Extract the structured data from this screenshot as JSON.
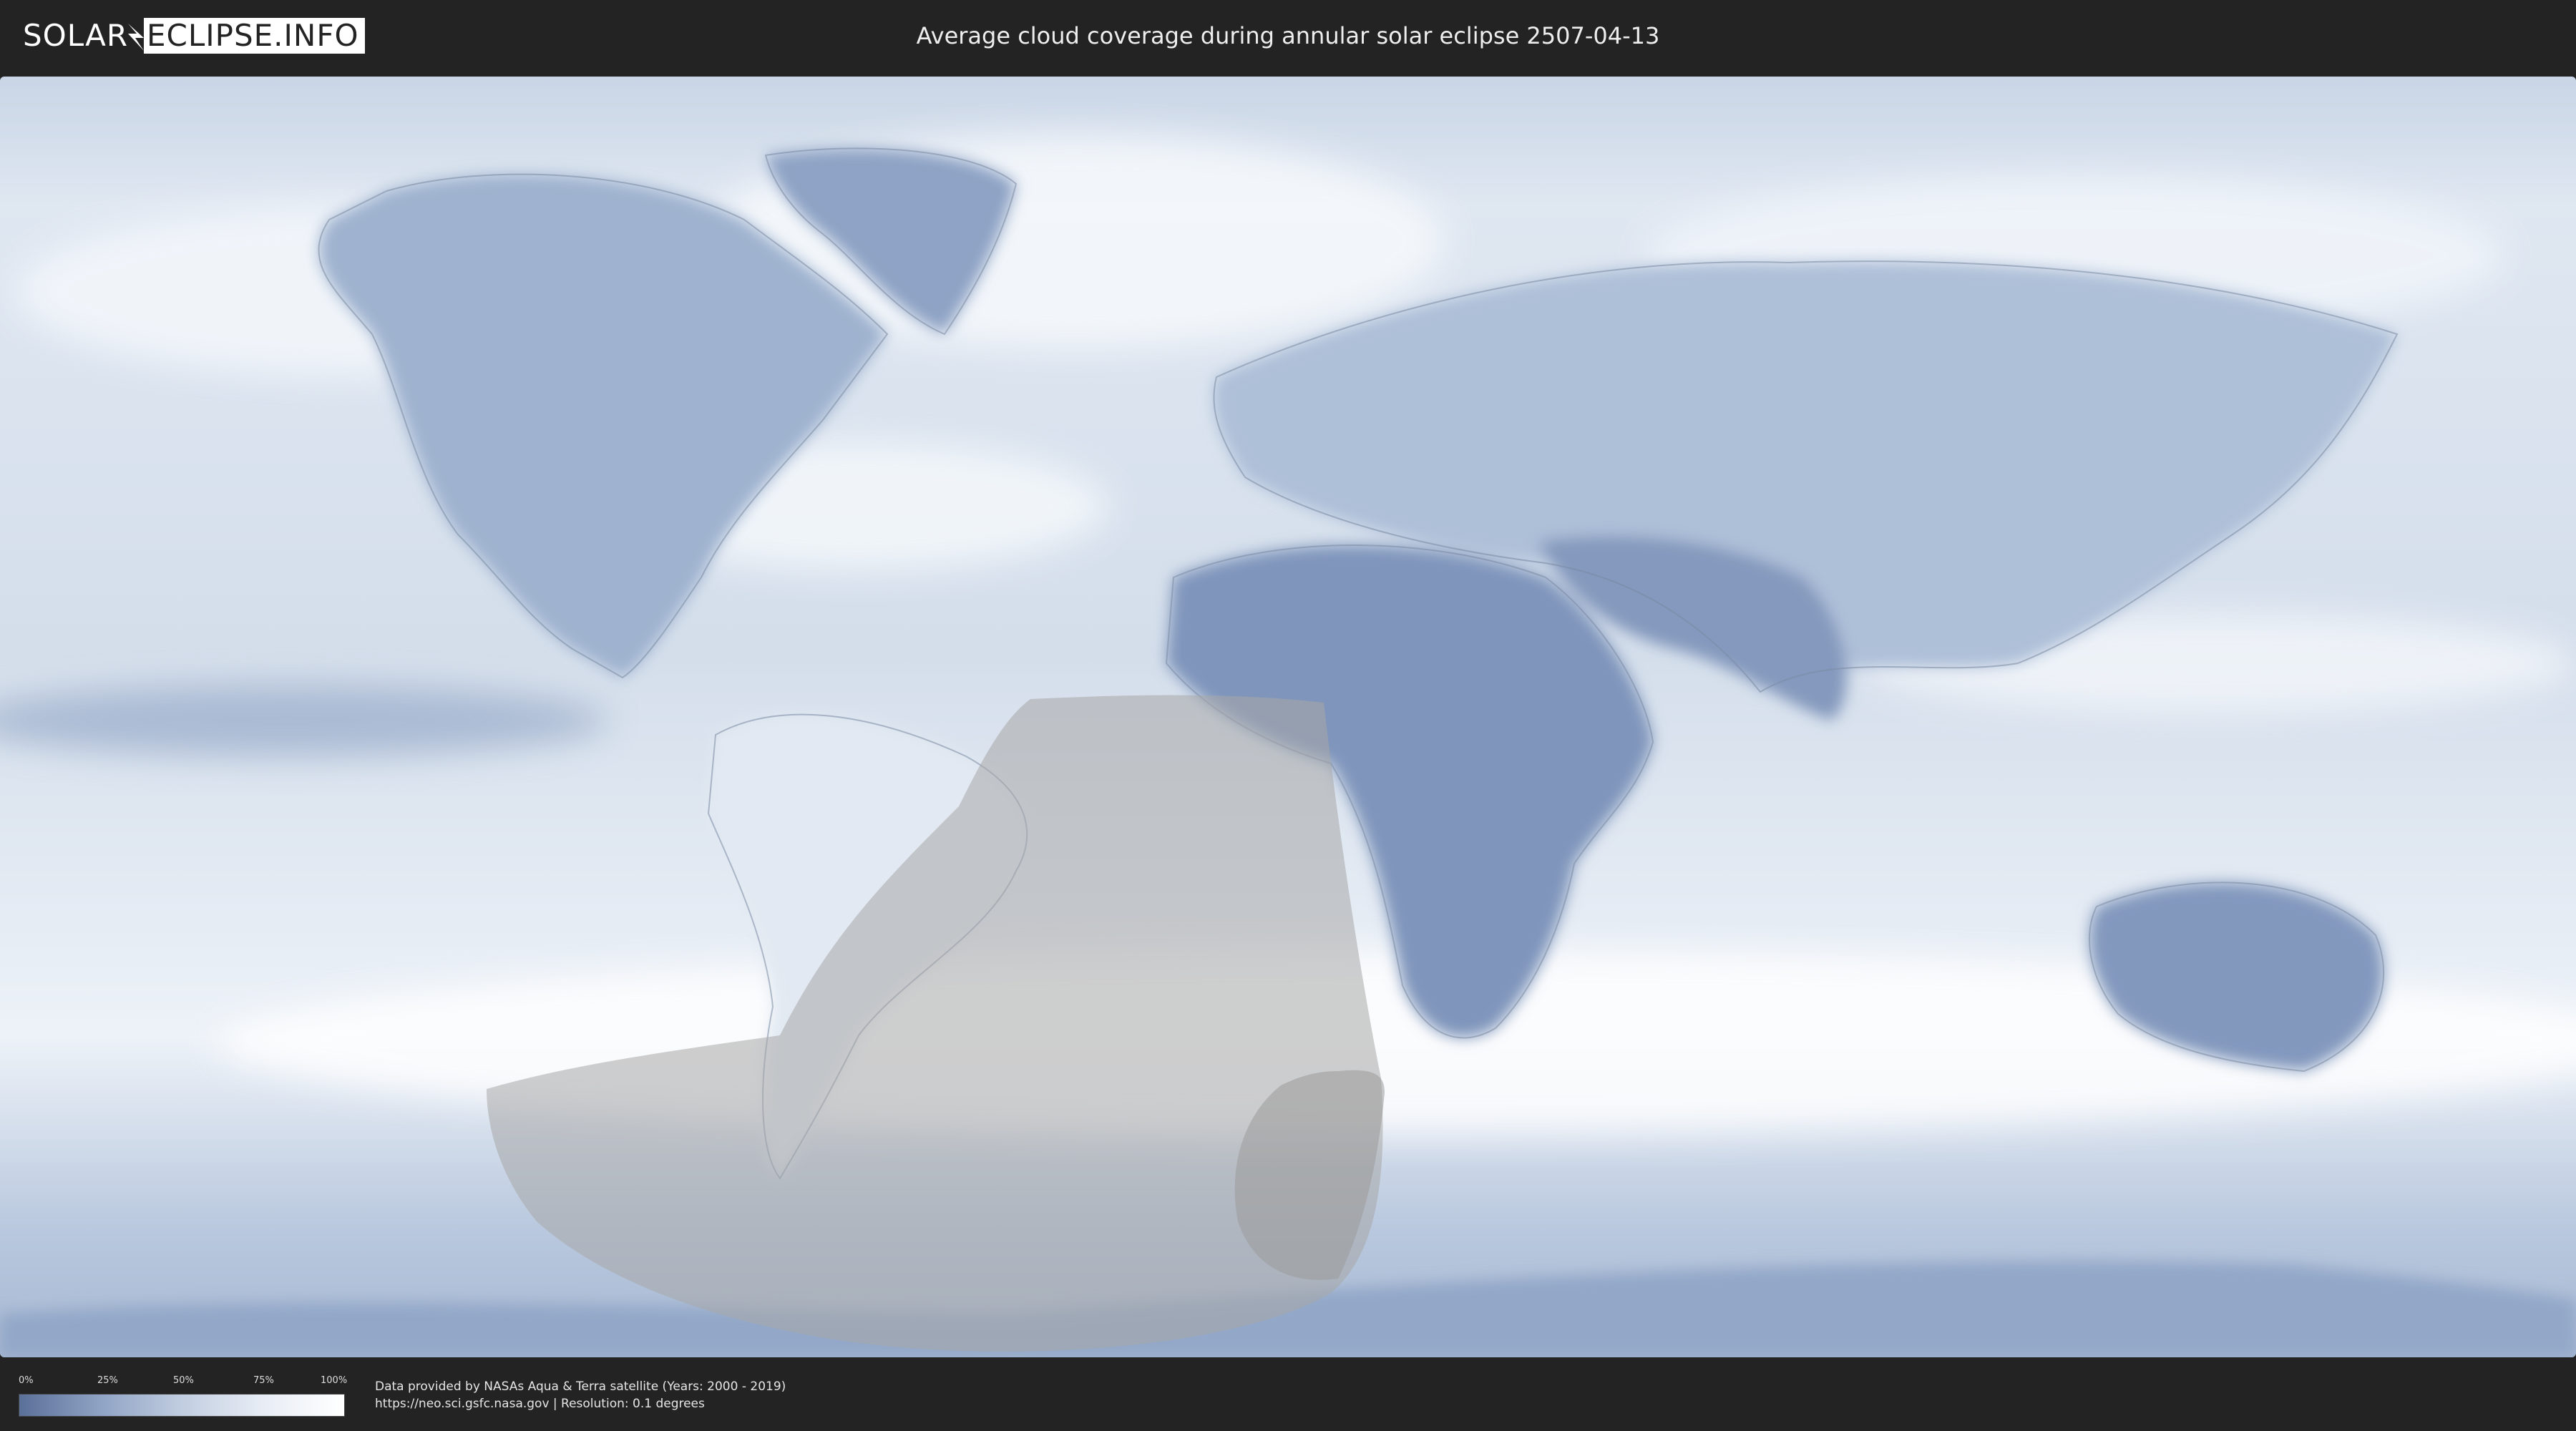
{
  "header": {
    "logo_part1": "SOLAR",
    "logo_part2": "ECLIPSE.INFO",
    "title": "Average cloud coverage during annular solar eclipse 2507-04-13"
  },
  "legend": {
    "labels": [
      "0%",
      "25%",
      "50%",
      "75%",
      "100%"
    ],
    "color_low": "#5b7099",
    "color_high": "#ffffff"
  },
  "footer": {
    "source_line1": "Data provided by NASAs Aqua & Terra satellite (Years: 2000 - 2019)",
    "source_line2": "https://neo.sci.gsfc.nasa.gov | Resolution: 0.1 degrees"
  },
  "colors": {
    "background": "#232323",
    "ocean_cloud": "#e3eaf3",
    "land_clear": "#7f95bb",
    "eclipse_overlay": "#b9b9b9"
  }
}
